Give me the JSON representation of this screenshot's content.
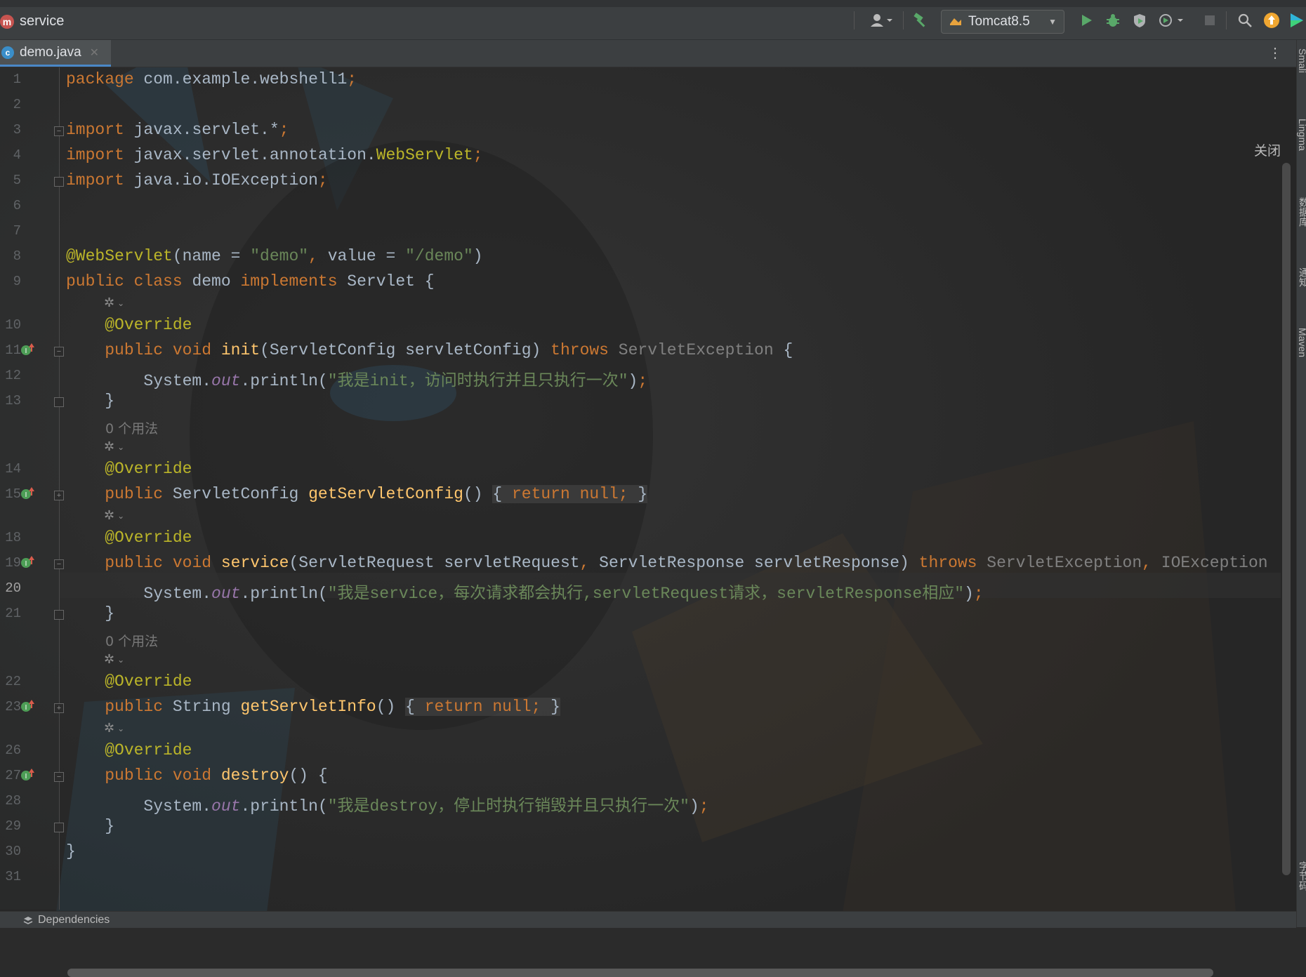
{
  "toolbar": {
    "project_name": "service",
    "module_icon_letter": "m",
    "run_config": "Tomcat8.5"
  },
  "tabs": [
    {
      "label": "demo.java",
      "icon_letter": "c"
    }
  ],
  "editor": {
    "close_label": "关闭",
    "usages_hint": "0 个用法",
    "line_numbers": [
      "1",
      "2",
      "3",
      "4",
      "5",
      "6",
      "7",
      "8",
      "9",
      "10",
      "11",
      "12",
      "13",
      "14",
      "15",
      "18",
      "19",
      "20",
      "21",
      "22",
      "23",
      "26",
      "27",
      "28",
      "29",
      "30",
      "31"
    ]
  },
  "right_strip": {
    "items": [
      "Smali",
      "Lingma",
      "数据库",
      "通知",
      "Maven",
      "字节码"
    ]
  },
  "bottom": {
    "dependencies": "Dependencies"
  },
  "icons": [
    "module-icon",
    "user-icon",
    "hammer-icon",
    "tomcat-icon",
    "run-icon",
    "debug-icon",
    "coverage-icon",
    "profile-icon",
    "stop-icon",
    "search-icon",
    "update-icon",
    "plugin-icon",
    "class-icon",
    "close-icon",
    "more-icon",
    "override-icon",
    "ai-lens-icon",
    "fold-icon"
  ],
  "colors": {
    "keyword": "#cc7832",
    "string": "#6a8759",
    "annotation": "#bbb529",
    "method": "#ffc66d",
    "field": "#9876aa",
    "text": "#a9b7c6"
  }
}
